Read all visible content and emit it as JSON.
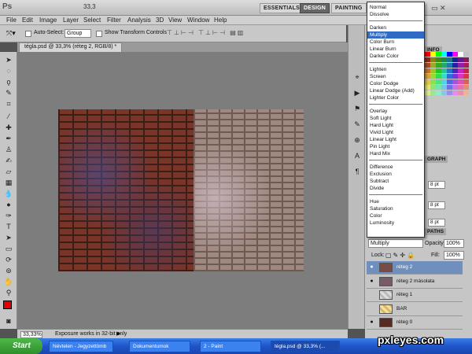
{
  "app": {
    "logo": "Ps",
    "menus": [
      "File",
      "Edit",
      "Image",
      "Layer",
      "Select",
      "Filter",
      "Analysis",
      "3D",
      "View",
      "Window",
      "Help"
    ],
    "zoom": "33,3",
    "workspaces": [
      "ESSENTIALS",
      "DESIGN",
      "PAINTING"
    ],
    "active_workspace": "DESIGN"
  },
  "options": {
    "auto_select": "Auto-Select:",
    "group": "Group",
    "transform": "Show Transform Controls"
  },
  "document": {
    "tab": "tégla.psd @ 33,3% (réteg 2, RGB/8) *"
  },
  "status": {
    "zoom": "33,33%",
    "message": "Exposure works in 32-bit only"
  },
  "blend_modes": {
    "selected": "Multiply",
    "groups": [
      [
        "Normal",
        "Dissolve"
      ],
      [
        "Darken",
        "Multiply",
        "Color Burn",
        "Linear Burn",
        "Darker Color"
      ],
      [
        "Lighten",
        "Screen",
        "Color Dodge",
        "Linear Dodge (Add)",
        "Lighter Color"
      ],
      [
        "Overlay",
        "Soft Light",
        "Hard Light",
        "Vivid Light",
        "Linear Light",
        "Pin Light",
        "Hard Mix"
      ],
      [
        "Difference",
        "Exclusion",
        "Subtract",
        "Divide"
      ],
      [
        "Hue",
        "Saturation",
        "Color",
        "Luminosity"
      ]
    ]
  },
  "panels": {
    "info_tab": "INFO",
    "graph_tab": "GRAPH",
    "paths_tab": "PATHS",
    "pt1": "8 pt",
    "pt2": "8 pt",
    "pt3": "8 pt"
  },
  "layers": {
    "mode": "Multiply",
    "opacity_label": "Opacity:",
    "opacity": "100%",
    "lock_label": "Lock:",
    "fill_label": "Fill:",
    "fill": "100%",
    "items": [
      {
        "name": "réteg 2",
        "visible": true,
        "active": true
      },
      {
        "name": "réteg 2 másolata",
        "visible": true,
        "active": false
      },
      {
        "name": "réteg 1",
        "visible": false,
        "active": false
      },
      {
        "name": "BAR",
        "visible": false,
        "active": false
      },
      {
        "name": "réteg 0",
        "visible": true,
        "active": false
      }
    ]
  },
  "taskbar": {
    "start": "Start",
    "items": [
      "Névtelen - Jegyzettömb",
      "Dokumentumok",
      "2 - Paint",
      "tégla.psd @ 33,3% (..."
    ]
  },
  "watermark": "pxleyes.com",
  "colors": {
    "accent": "#316ac5",
    "fg": "#e00000",
    "bg": "#ffffff"
  }
}
